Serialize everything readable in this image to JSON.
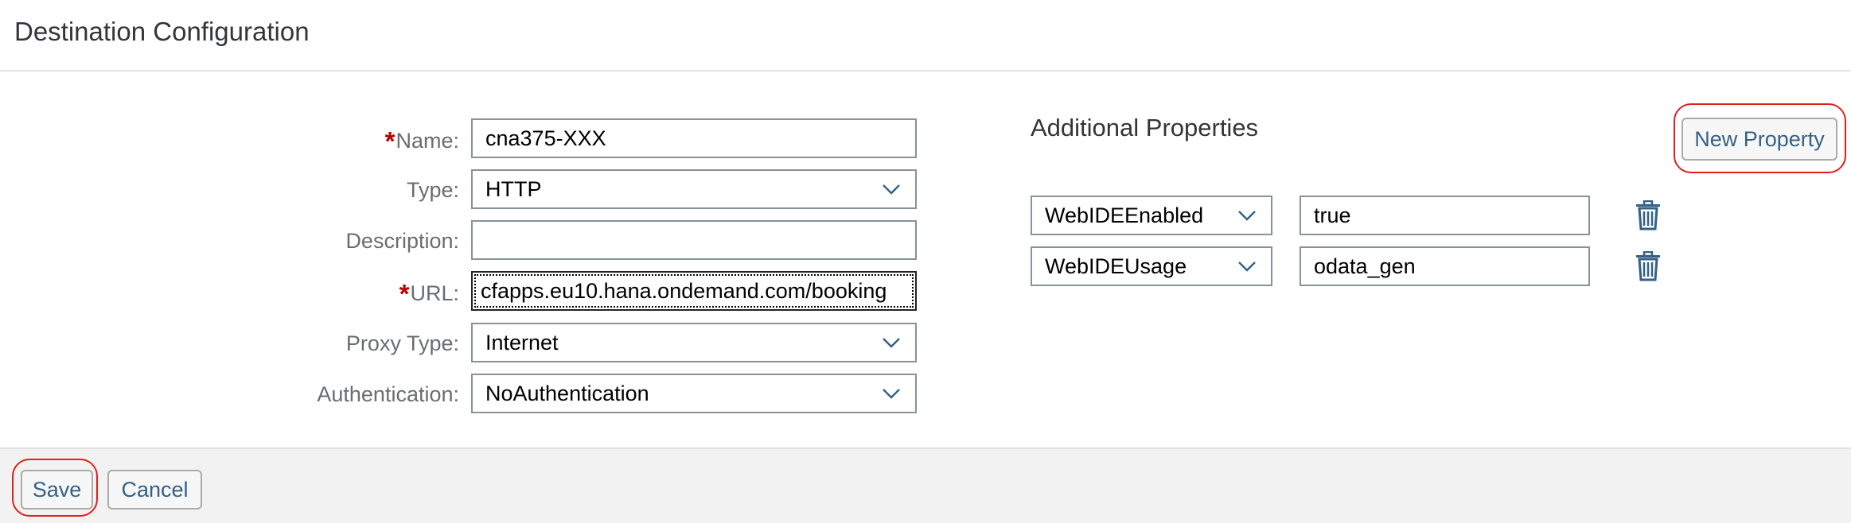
{
  "header": {
    "title": "Destination Configuration"
  },
  "form": {
    "name": {
      "label": "Name:",
      "required_mark": "*",
      "value": "cna375-XXX"
    },
    "type": {
      "label": "Type:",
      "value": "HTTP"
    },
    "description": {
      "label": "Description:",
      "value": ""
    },
    "url": {
      "label": "URL:",
      "required_mark": "*",
      "value": "cfapps.eu10.hana.ondemand.com/booking"
    },
    "proxy_type": {
      "label": "Proxy Type:",
      "value": "Internet"
    },
    "authentication": {
      "label": "Authentication:",
      "value": "NoAuthentication"
    }
  },
  "additional_properties": {
    "title": "Additional Properties",
    "new_property_label": "New Property",
    "rows": [
      {
        "key": "WebIDEEnabled",
        "value": "true"
      },
      {
        "key": "WebIDEUsage",
        "value": "odata_gen"
      }
    ]
  },
  "footer": {
    "save_label": "Save",
    "cancel_label": "Cancel"
  },
  "colors": {
    "required": "#bb0000",
    "highlight_ring": "#e01e1e",
    "button_text": "#346187",
    "icon": "#346187"
  }
}
